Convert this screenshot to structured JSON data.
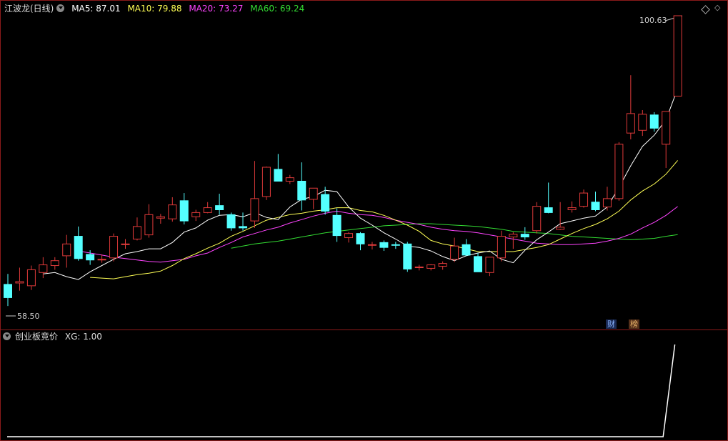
{
  "header": {
    "stock": "江波龙(日线)",
    "ma5": "MA5: 87.01",
    "ma10": "MA10: 79.88",
    "ma20": "MA20: 73.27",
    "ma60": "MA60: 69.24"
  },
  "sub_header": {
    "title": "创业板竞价",
    "xg": "XG: 1.00"
  },
  "labels": {
    "high": "100.63",
    "low": "58.50",
    "tag_cai": "财",
    "tag_bang": "榜"
  },
  "colors": {
    "up": "#e03a3a",
    "down": "#54ffff",
    "ma5": "#ffffff",
    "ma10": "#ffff55",
    "ma20": "#ff44ff",
    "ma60": "#33dd33",
    "frame": "#8b1a1a"
  },
  "chart_data": [
    {
      "type": "candlestick",
      "title": "江波龙(日线)",
      "ylim": [
        58.5,
        100.63
      ],
      "candles": [
        [
          62.1,
          63.6,
          59.0,
          60.2
        ],
        [
          62.3,
          64.5,
          61.2,
          62.5
        ],
        [
          61.9,
          64.8,
          61.3,
          64.2
        ],
        [
          63.8,
          66.0,
          63.0,
          64.9
        ],
        [
          64.8,
          66.0,
          64.2,
          65.5
        ],
        [
          66.2,
          69.2,
          64.5,
          67.9
        ],
        [
          69.0,
          70.4,
          65.5,
          65.8
        ],
        [
          66.4,
          67.0,
          64.9,
          65.6
        ],
        [
          65.6,
          66.4,
          65.2,
          65.7
        ],
        [
          65.9,
          69.4,
          65.4,
          69.0
        ],
        [
          67.8,
          68.6,
          67.2,
          67.9
        ],
        [
          68.6,
          71.7,
          68.4,
          70.4
        ],
        [
          69.2,
          73.6,
          68.8,
          72.1
        ],
        [
          71.6,
          72.2,
          70.8,
          71.8
        ],
        [
          71.5,
          74.6,
          71.1,
          73.5
        ],
        [
          74.1,
          75.2,
          70.7,
          71.2
        ],
        [
          71.8,
          72.8,
          71.2,
          72.4
        ],
        [
          72.4,
          73.9,
          72.3,
          73.1
        ],
        [
          73.4,
          75.1,
          72.1,
          72.8
        ],
        [
          72.1,
          72.4,
          69.8,
          70.2
        ],
        [
          70.4,
          72.4,
          69.8,
          70.2
        ],
        [
          71.2,
          79.8,
          70.2,
          74.4
        ],
        [
          74.7,
          79.0,
          74.2,
          78.9
        ],
        [
          78.6,
          80.8,
          76.9,
          76.9
        ],
        [
          76.9,
          77.8,
          76.5,
          77.4
        ],
        [
          76.9,
          79.6,
          72.7,
          74.2
        ],
        [
          74.3,
          75.8,
          72.9,
          75.9
        ],
        [
          75.0,
          76.1,
          72.1,
          72.6
        ],
        [
          72.0,
          73.0,
          68.2,
          69.1
        ],
        [
          68.8,
          69.6,
          68.1,
          69.4
        ],
        [
          69.4,
          69.6,
          67.0,
          67.9
        ],
        [
          67.7,
          68.2,
          67.1,
          67.8
        ],
        [
          68.1,
          68.4,
          66.9,
          67.4
        ],
        [
          67.8,
          68.2,
          67.2,
          67.7
        ],
        [
          67.9,
          68.2,
          63.9,
          64.3
        ],
        [
          64.6,
          64.9,
          64.1,
          64.6
        ],
        [
          64.4,
          65.0,
          64.1,
          64.9
        ],
        [
          64.7,
          65.4,
          64.2,
          65.1
        ],
        [
          65.7,
          68.8,
          65.3,
          67.6
        ],
        [
          67.8,
          68.6,
          66.2,
          66.3
        ],
        [
          66.1,
          66.6,
          63.9,
          63.9
        ],
        [
          63.8,
          65.9,
          63.3,
          66.0
        ],
        [
          65.9,
          69.8,
          65.4,
          69.0
        ],
        [
          68.9,
          69.6,
          67.2,
          69.3
        ],
        [
          69.3,
          70.3,
          68.5,
          68.9
        ],
        [
          69.8,
          73.9,
          69.4,
          73.3
        ],
        [
          73.1,
          76.7,
          72.3,
          72.4
        ],
        [
          70.0,
          73.9,
          69.9,
          70.3
        ],
        [
          72.8,
          74.0,
          72.4,
          73.1
        ],
        [
          73.3,
          75.7,
          73.1,
          75.2
        ],
        [
          73.9,
          75.4,
          72.6,
          72.8
        ],
        [
          73.2,
          76.1,
          72.7,
          74.4
        ],
        [
          74.4,
          82.5,
          74.1,
          82.2
        ],
        [
          83.8,
          92.1,
          82.9,
          86.6
        ],
        [
          84.2,
          87.1,
          83.4,
          86.5
        ],
        [
          86.4,
          86.8,
          84.0,
          84.5
        ],
        [
          82.2,
          86.6,
          78.8,
          86.9
        ],
        [
          89.1,
          100.63,
          89.1,
          100.63
        ]
      ],
      "ma5": [
        63.6,
        63.8,
        63.2,
        62.8,
        63.9,
        64.8,
        65.7,
        66.5,
        66.8,
        67.2,
        67.2,
        68.1,
        69.6,
        70.2,
        71.3,
        72.0,
        72.1,
        71.8,
        72.4,
        71.7,
        71.4,
        73.2,
        74.3,
        74.7,
        75.6,
        75.4,
        73.2,
        71.6,
        70.6,
        69.5,
        68.6,
        67.6,
        67.4,
        66.9,
        66.1,
        65.5,
        66.2,
        66.6,
        66.9,
        65.7,
        65.2,
        67.0,
        68.5,
        69.6,
        70.8,
        71.2,
        71.6,
        71.9,
        73.2,
        76.0,
        79.1,
        81.9,
        83.5,
        85.7,
        90.2
      ],
      "ma10": [
        63.1,
        63.0,
        62.9,
        63.2,
        63.5,
        63.7,
        64.0,
        64.8,
        65.8,
        66.5,
        67.3,
        68.0,
        69.0,
        69.7,
        70.5,
        71.3,
        71.7,
        72.1,
        72.3,
        72.6,
        72.8,
        73.1,
        73.1,
        72.7,
        72.5,
        72.0,
        71.3,
        70.6,
        69.7,
        68.4,
        67.9,
        67.6,
        67.2,
        66.8,
        66.8,
        66.8,
        66.8,
        67.1,
        67.4,
        67.8,
        68.6,
        69.4,
        70.1,
        70.7,
        71.5,
        72.6,
        74.2,
        75.5,
        76.5,
        77.9,
        79.88
      ],
      "ma20": [
        66.9,
        66.6,
        66.3,
        66.0,
        65.8,
        65.6,
        65.4,
        65.3,
        65.5,
        65.7,
        66.2,
        66.6,
        67.4,
        68.1,
        68.9,
        69.4,
        69.9,
        70.3,
        70.9,
        71.4,
        71.9,
        72.3,
        72.6,
        72.3,
        72.1,
        72.0,
        71.7,
        71.3,
        71.0,
        70.7,
        70.3,
        70.0,
        69.8,
        69.7,
        69.5,
        69.2,
        68.9,
        68.6,
        68.3,
        68.0,
        67.9,
        67.8,
        67.8,
        67.9,
        68.0,
        68.3,
        68.7,
        69.3,
        70.2,
        71.0,
        72.0,
        73.27
      ],
      "ma60": [
        67.3,
        67.6,
        67.9,
        68.1,
        68.3,
        68.6,
        68.9,
        69.2,
        69.5,
        69.7,
        69.9,
        70.1,
        70.3,
        70.5,
        70.6,
        70.7,
        70.8,
        70.8,
        70.7,
        70.6,
        70.5,
        70.4,
        70.2,
        70.0,
        69.7,
        69.6,
        69.5,
        69.4,
        69.2,
        69.0,
        68.9,
        68.8,
        68.7,
        68.6,
        68.5,
        68.6,
        68.7,
        69.0,
        69.24
      ]
    },
    {
      "type": "line",
      "title": "创业板竞价",
      "series": [
        {
          "name": "XG",
          "values": [
            0,
            0,
            0,
            0,
            0,
            0,
            0,
            0,
            0,
            0,
            0,
            0,
            0,
            0,
            0,
            0,
            0,
            0,
            0,
            0,
            0,
            0,
            0,
            0,
            0,
            0,
            0,
            0,
            0,
            0,
            0,
            0,
            0,
            0,
            0,
            0,
            0,
            0,
            0,
            0,
            0,
            0,
            0,
            0,
            0,
            0,
            0,
            0,
            0,
            0,
            0,
            0,
            0,
            0,
            0,
            0,
            0,
            1.0
          ]
        }
      ],
      "ylim": [
        0,
        1
      ]
    }
  ]
}
